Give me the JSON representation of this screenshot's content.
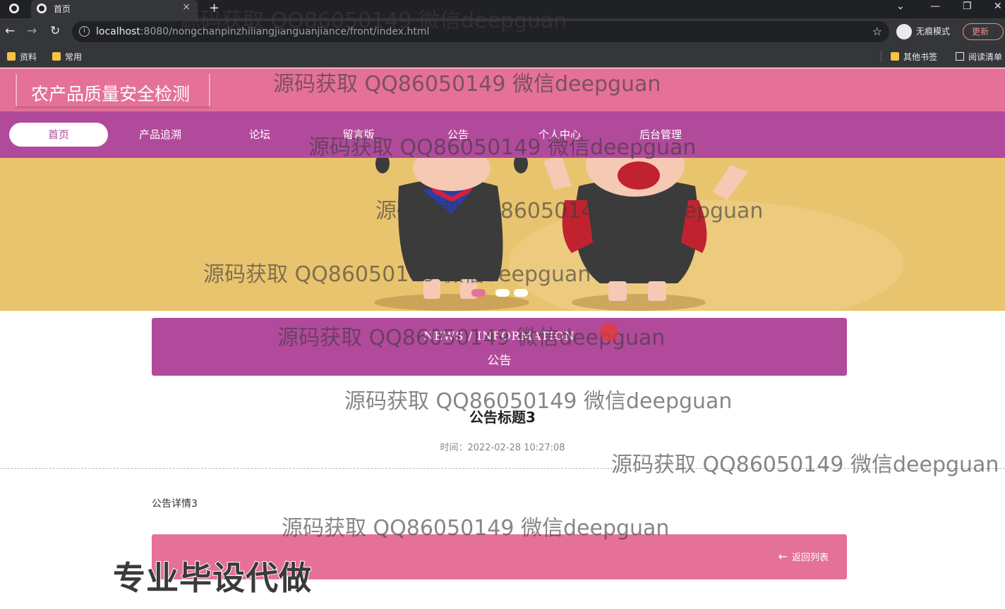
{
  "browser": {
    "tab_title": "首页",
    "tab_close": "×",
    "new_tab": "+",
    "url_host": "localhost",
    "url_rest": ":8080/nongchanpinzhiliangjianguanjiance/front/index.html",
    "incognito_label": "无痕模式",
    "update_label": "更新",
    "bookmarks": [
      "资料",
      "常用"
    ],
    "bookmarks_right": [
      "其他书签",
      "阅读清单"
    ]
  },
  "site": {
    "title": "农产品质量安全检测"
  },
  "nav": {
    "items": [
      {
        "label": "首页",
        "active": true
      },
      {
        "label": "产品追溯",
        "active": false
      },
      {
        "label": "论坛",
        "active": false
      },
      {
        "label": "留言版",
        "active": false
      },
      {
        "label": "公告",
        "active": false
      },
      {
        "label": "个人中心",
        "active": false
      },
      {
        "label": "后台管理",
        "active": false
      }
    ]
  },
  "banner": {
    "slide_count": 3,
    "active_slide": 1
  },
  "section": {
    "en": "NEWS / INFORMATION",
    "cn": "公告"
  },
  "notice": {
    "title": "公告标题3",
    "time": "时间：2022-02-28 10:27:08",
    "content": "公告详情3"
  },
  "back_button": {
    "arrow": "←",
    "label": "返回列表"
  },
  "promo_text": "专业毕设代做",
  "watermark": "源码获取 QQ86050149 微信deepguan",
  "colors": {
    "header_pink": "#e57198",
    "nav_purple": "#b24a9c",
    "banner_yellow": "#e9c46f"
  }
}
